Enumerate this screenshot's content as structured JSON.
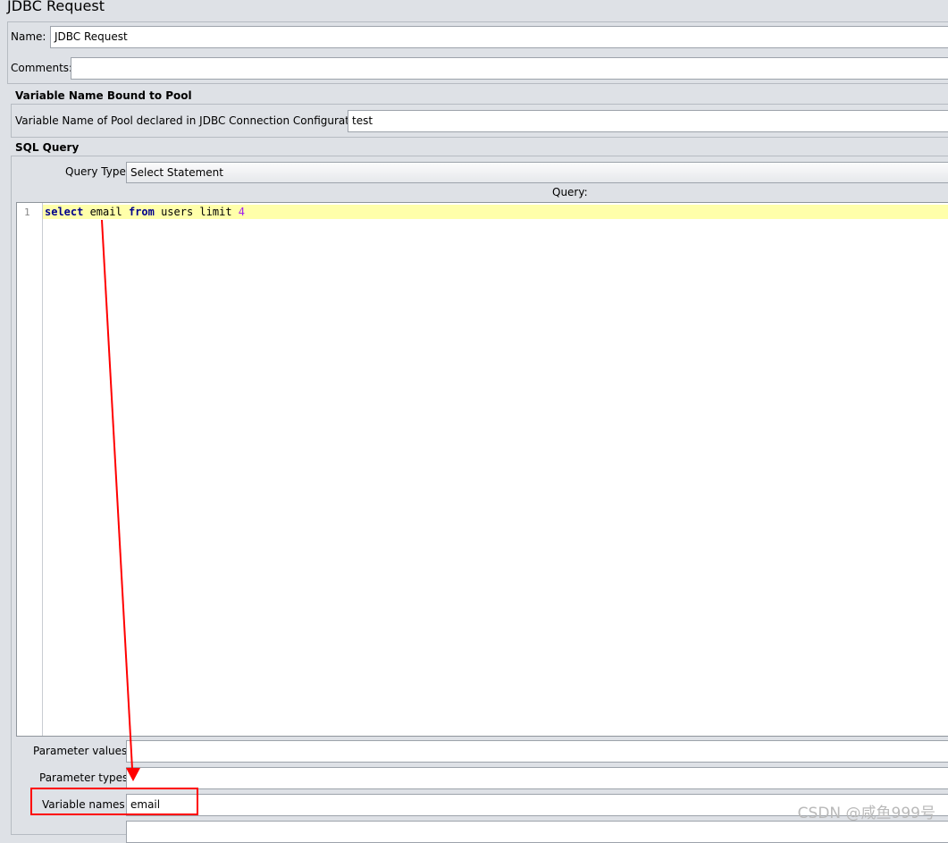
{
  "window": {
    "title": "JDBC Request"
  },
  "general": {
    "name_label": "Name:",
    "name_value": "JDBC Request",
    "comments_label": "Comments:",
    "comments_value": ""
  },
  "pool": {
    "section_title": "Variable Name Bound to Pool",
    "label": "Variable Name of Pool declared in JDBC Connection Configuration:",
    "value": "test"
  },
  "sql": {
    "section_title": "SQL Query",
    "query_type_label": "Query Type:",
    "query_type_value": "Select Statement",
    "query_label": "Query:",
    "line_number": "1",
    "code_tokens": {
      "t1": "select",
      "t2": " email ",
      "t3": "from",
      "t4": " users limit ",
      "t5": "4"
    }
  },
  "params": {
    "values_label": "Parameter values:",
    "values_value": "",
    "types_label": "Parameter types:",
    "types_value": "",
    "varnames_label": "Variable names:",
    "varnames_value": "email"
  },
  "annotation": {
    "arrow_color": "#ff0000",
    "highlight_color": "#ff0000"
  },
  "watermark": "CSDN @咸鱼999号"
}
